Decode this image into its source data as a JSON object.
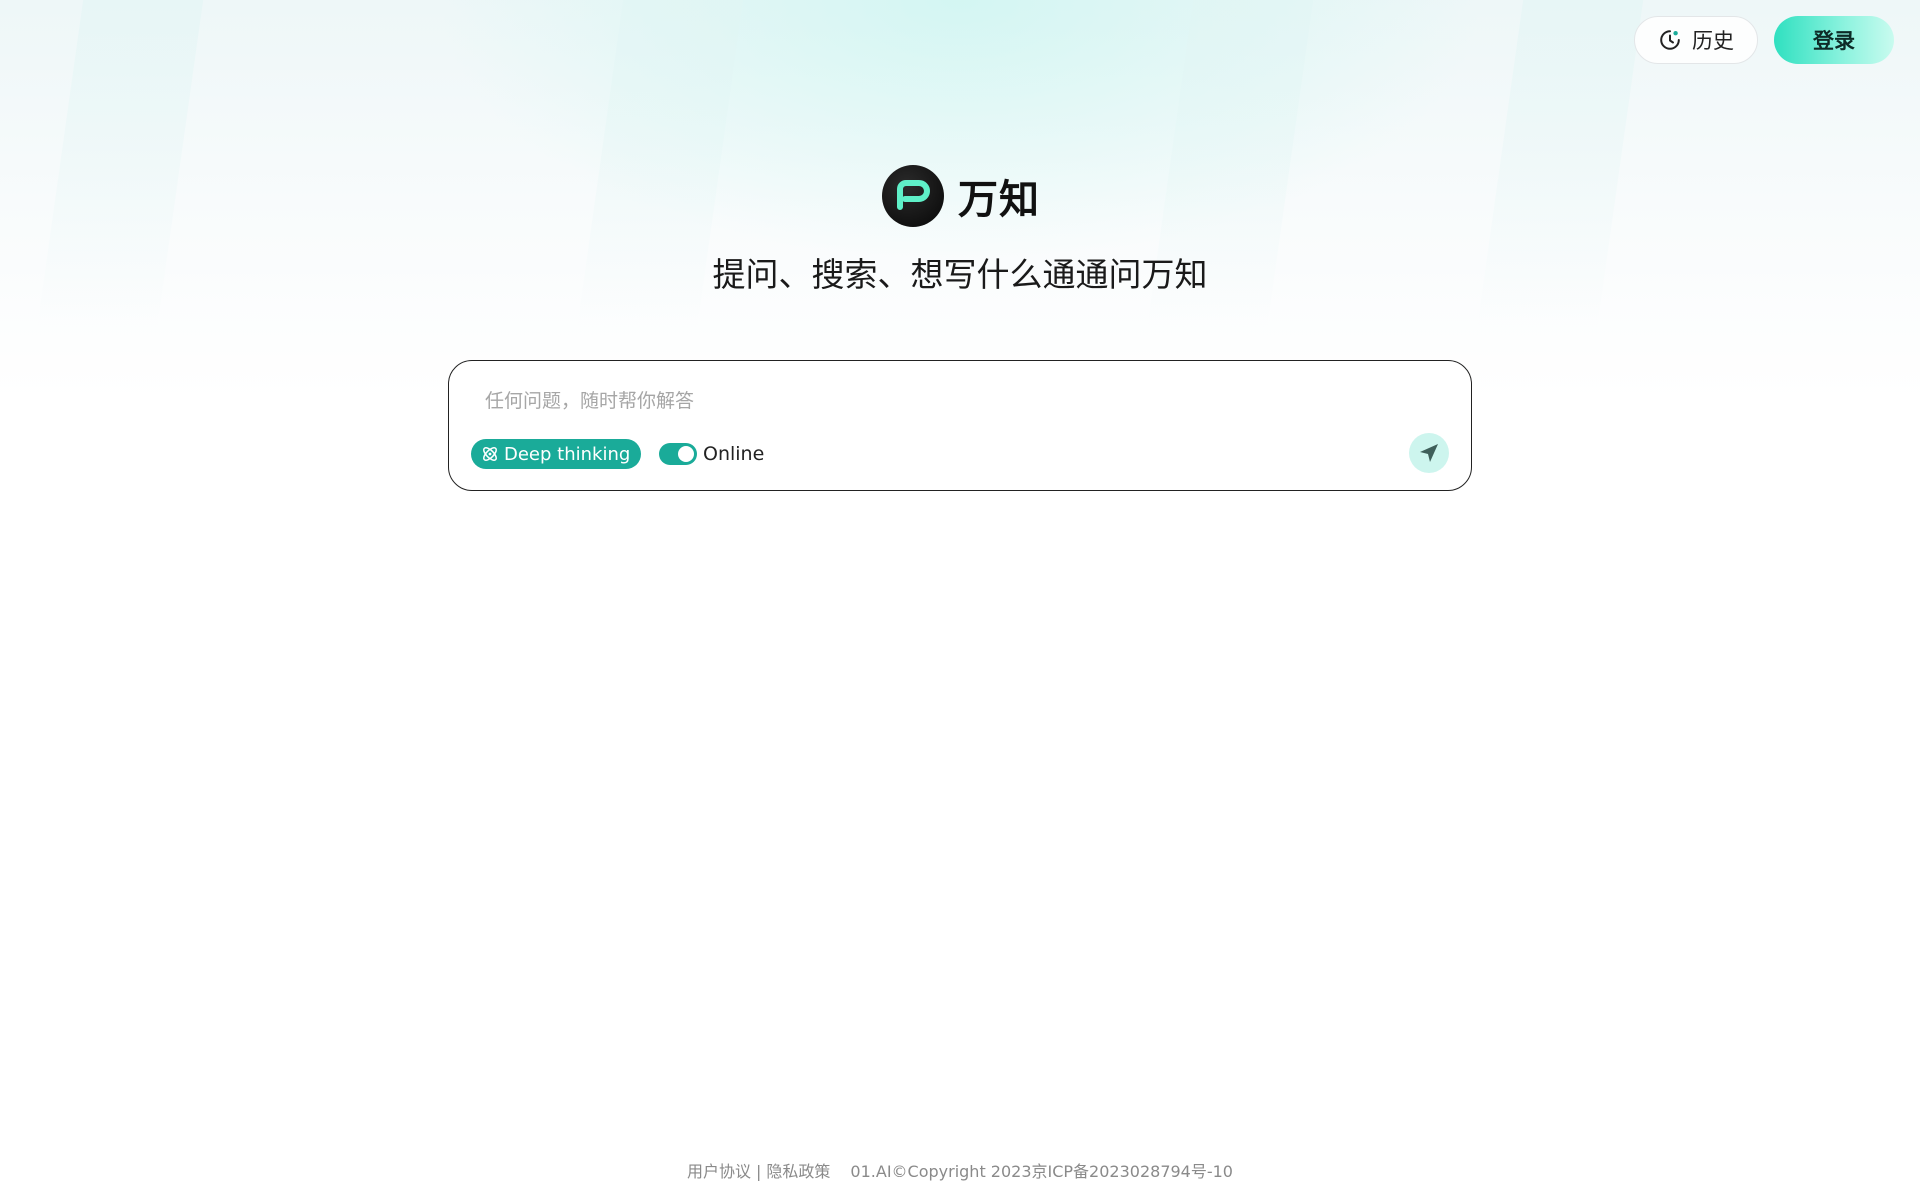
{
  "header": {
    "history_label": "历史",
    "login_label": "登录"
  },
  "brand": {
    "name": "万知",
    "tagline": "提问、搜索、想写什么通通问万知"
  },
  "composer": {
    "placeholder": "任何问题，随时帮你解答",
    "deep_thinking_label": "Deep thinking",
    "online_label": "Online",
    "online_enabled": true
  },
  "footer": {
    "user_agreement": "用户协议",
    "separator": "|",
    "privacy_policy": "隐私政策",
    "copyright": "01.AI©Copyright 2023京ICP备2023028794号-10"
  },
  "colors": {
    "accent": "#1aab99",
    "login_gradient_start": "#2fe0c0",
    "send_button_bg": "#cdf5ee"
  }
}
